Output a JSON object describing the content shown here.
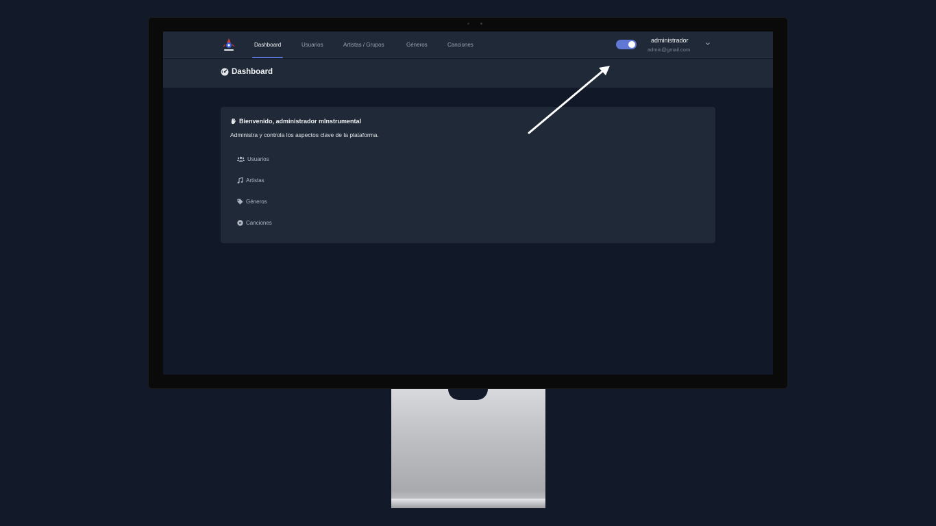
{
  "navbar": {
    "items": [
      {
        "label": "Dashboard",
        "active": true
      },
      {
        "label": "Usuarios",
        "active": false
      },
      {
        "label": "Artistas / Grupos",
        "active": false
      },
      {
        "label": "Géneros",
        "active": false
      },
      {
        "label": "Canciones",
        "active": false
      }
    ],
    "theme_toggle_on": true,
    "user": {
      "name": "administrador",
      "email": "admin@gmail.com"
    }
  },
  "page_header": {
    "title": "Dashboard",
    "icon": "dashboard-gauge-icon"
  },
  "welcome_card": {
    "title": "Bienvenido, administrador mInstrumental",
    "title_icon": "waving-hand-icon",
    "subtitle": "Administra y controla los aspectos clave de la plataforma.",
    "links": [
      {
        "label": "Usuarios",
        "icon": "users-icon"
      },
      {
        "label": "Artistas",
        "icon": "music-note-icon"
      },
      {
        "label": "Géneros",
        "icon": "tag-icon"
      },
      {
        "label": "Canciones",
        "icon": "play-circle-icon"
      }
    ]
  },
  "colors": {
    "background": "#121a29",
    "navbar": "#1f2937",
    "screen": "#111827",
    "accent": "#5b74d6",
    "toggle": "#6177d4"
  }
}
